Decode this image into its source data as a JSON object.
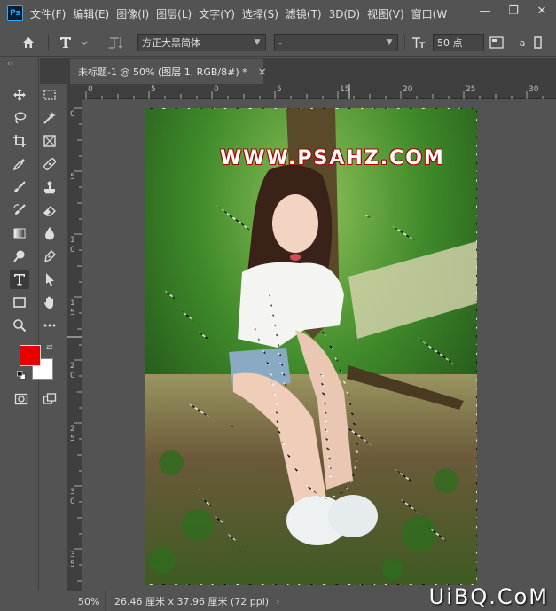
{
  "app": {
    "logo": "Ps"
  },
  "menu": [
    "文件(F)",
    "编辑(E)",
    "图像(I)",
    "图层(L)",
    "文字(Y)",
    "选择(S)",
    "滤镜(T)",
    "3D(D)",
    "视图(V)",
    "窗口(W"
  ],
  "window_controls": {
    "minimize": "—",
    "restore": "❐",
    "close": "✕"
  },
  "options_bar": {
    "font_family": "方正大黑简体",
    "font_style": "-",
    "font_size": "50 点",
    "aa_label": "a"
  },
  "toolbar": {
    "collapse": "‹‹",
    "foreground_color": "#e60000",
    "background_color": "#ffffff",
    "active_tool": "type-tool"
  },
  "document": {
    "tab_title": "未标题-1 @ 50% (图层 1, RGB/8#) *",
    "close": "×",
    "overlay_text": "WWW.PSAHZ.COM"
  },
  "rulers": {
    "horizontal": [
      "0",
      "5",
      "0",
      "5",
      "10",
      "15",
      "20",
      "25",
      "30"
    ],
    "vertical": [
      "0",
      "5",
      "10",
      "15",
      "20",
      "25",
      "30",
      "35"
    ]
  },
  "status": {
    "zoom": "50%",
    "doc_info": "26.46 厘米 x 37.96 厘米 (72 ppi)",
    "arrow": "›"
  },
  "watermark": "UiBQ.CoM"
}
